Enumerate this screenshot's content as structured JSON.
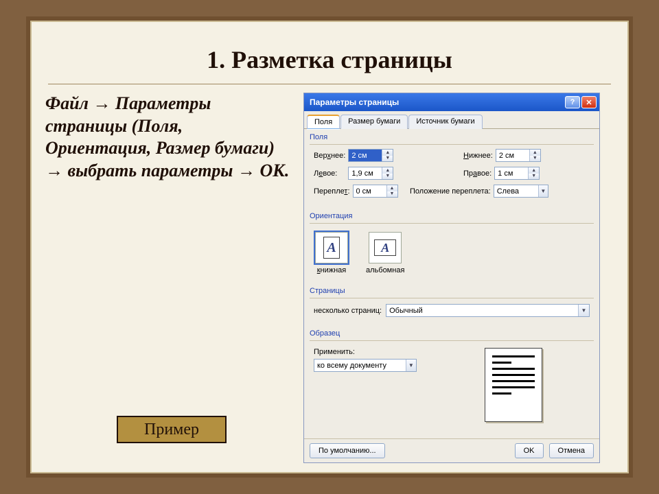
{
  "slide": {
    "title": "1. Разметка страницы",
    "body": "Файл → Параметры страницы (Поля, Ориентация, Размер бумаги) → выбрать параметры → ОК.",
    "example_button": "Пример"
  },
  "dialog": {
    "title": "Параметры страницы",
    "help_btn": "?",
    "close_btn": "✕",
    "tabs": [
      "Поля",
      "Размер бумаги",
      "Источник бумаги"
    ],
    "active_tab": 0,
    "fields_group": "Поля",
    "fields": {
      "top_label": "Верхнее:",
      "top_value": "2 см",
      "bottom_label": "Нижнее:",
      "bottom_value": "2 см",
      "left_label": "Левое:",
      "left_value": "1,9 см",
      "right_label": "Правое:",
      "right_value": "1 см",
      "gutter_label": "Переплет:",
      "gutter_value": "0 см",
      "gutter_pos_label": "Положение переплета:",
      "gutter_pos_value": "Слева"
    },
    "orient_group": "Ориентация",
    "orient": {
      "portrait": "книжная",
      "landscape": "альбомная"
    },
    "pages_group": "Страницы",
    "pages": {
      "multi_label": "несколько страниц:",
      "multi_value": "Обычный"
    },
    "sample_group": "Образец",
    "sample": {
      "apply_label": "Применить:",
      "apply_value": "ко всему документу"
    },
    "buttons": {
      "default": "По умолчанию...",
      "ok": "OK",
      "cancel": "Отмена"
    }
  }
}
